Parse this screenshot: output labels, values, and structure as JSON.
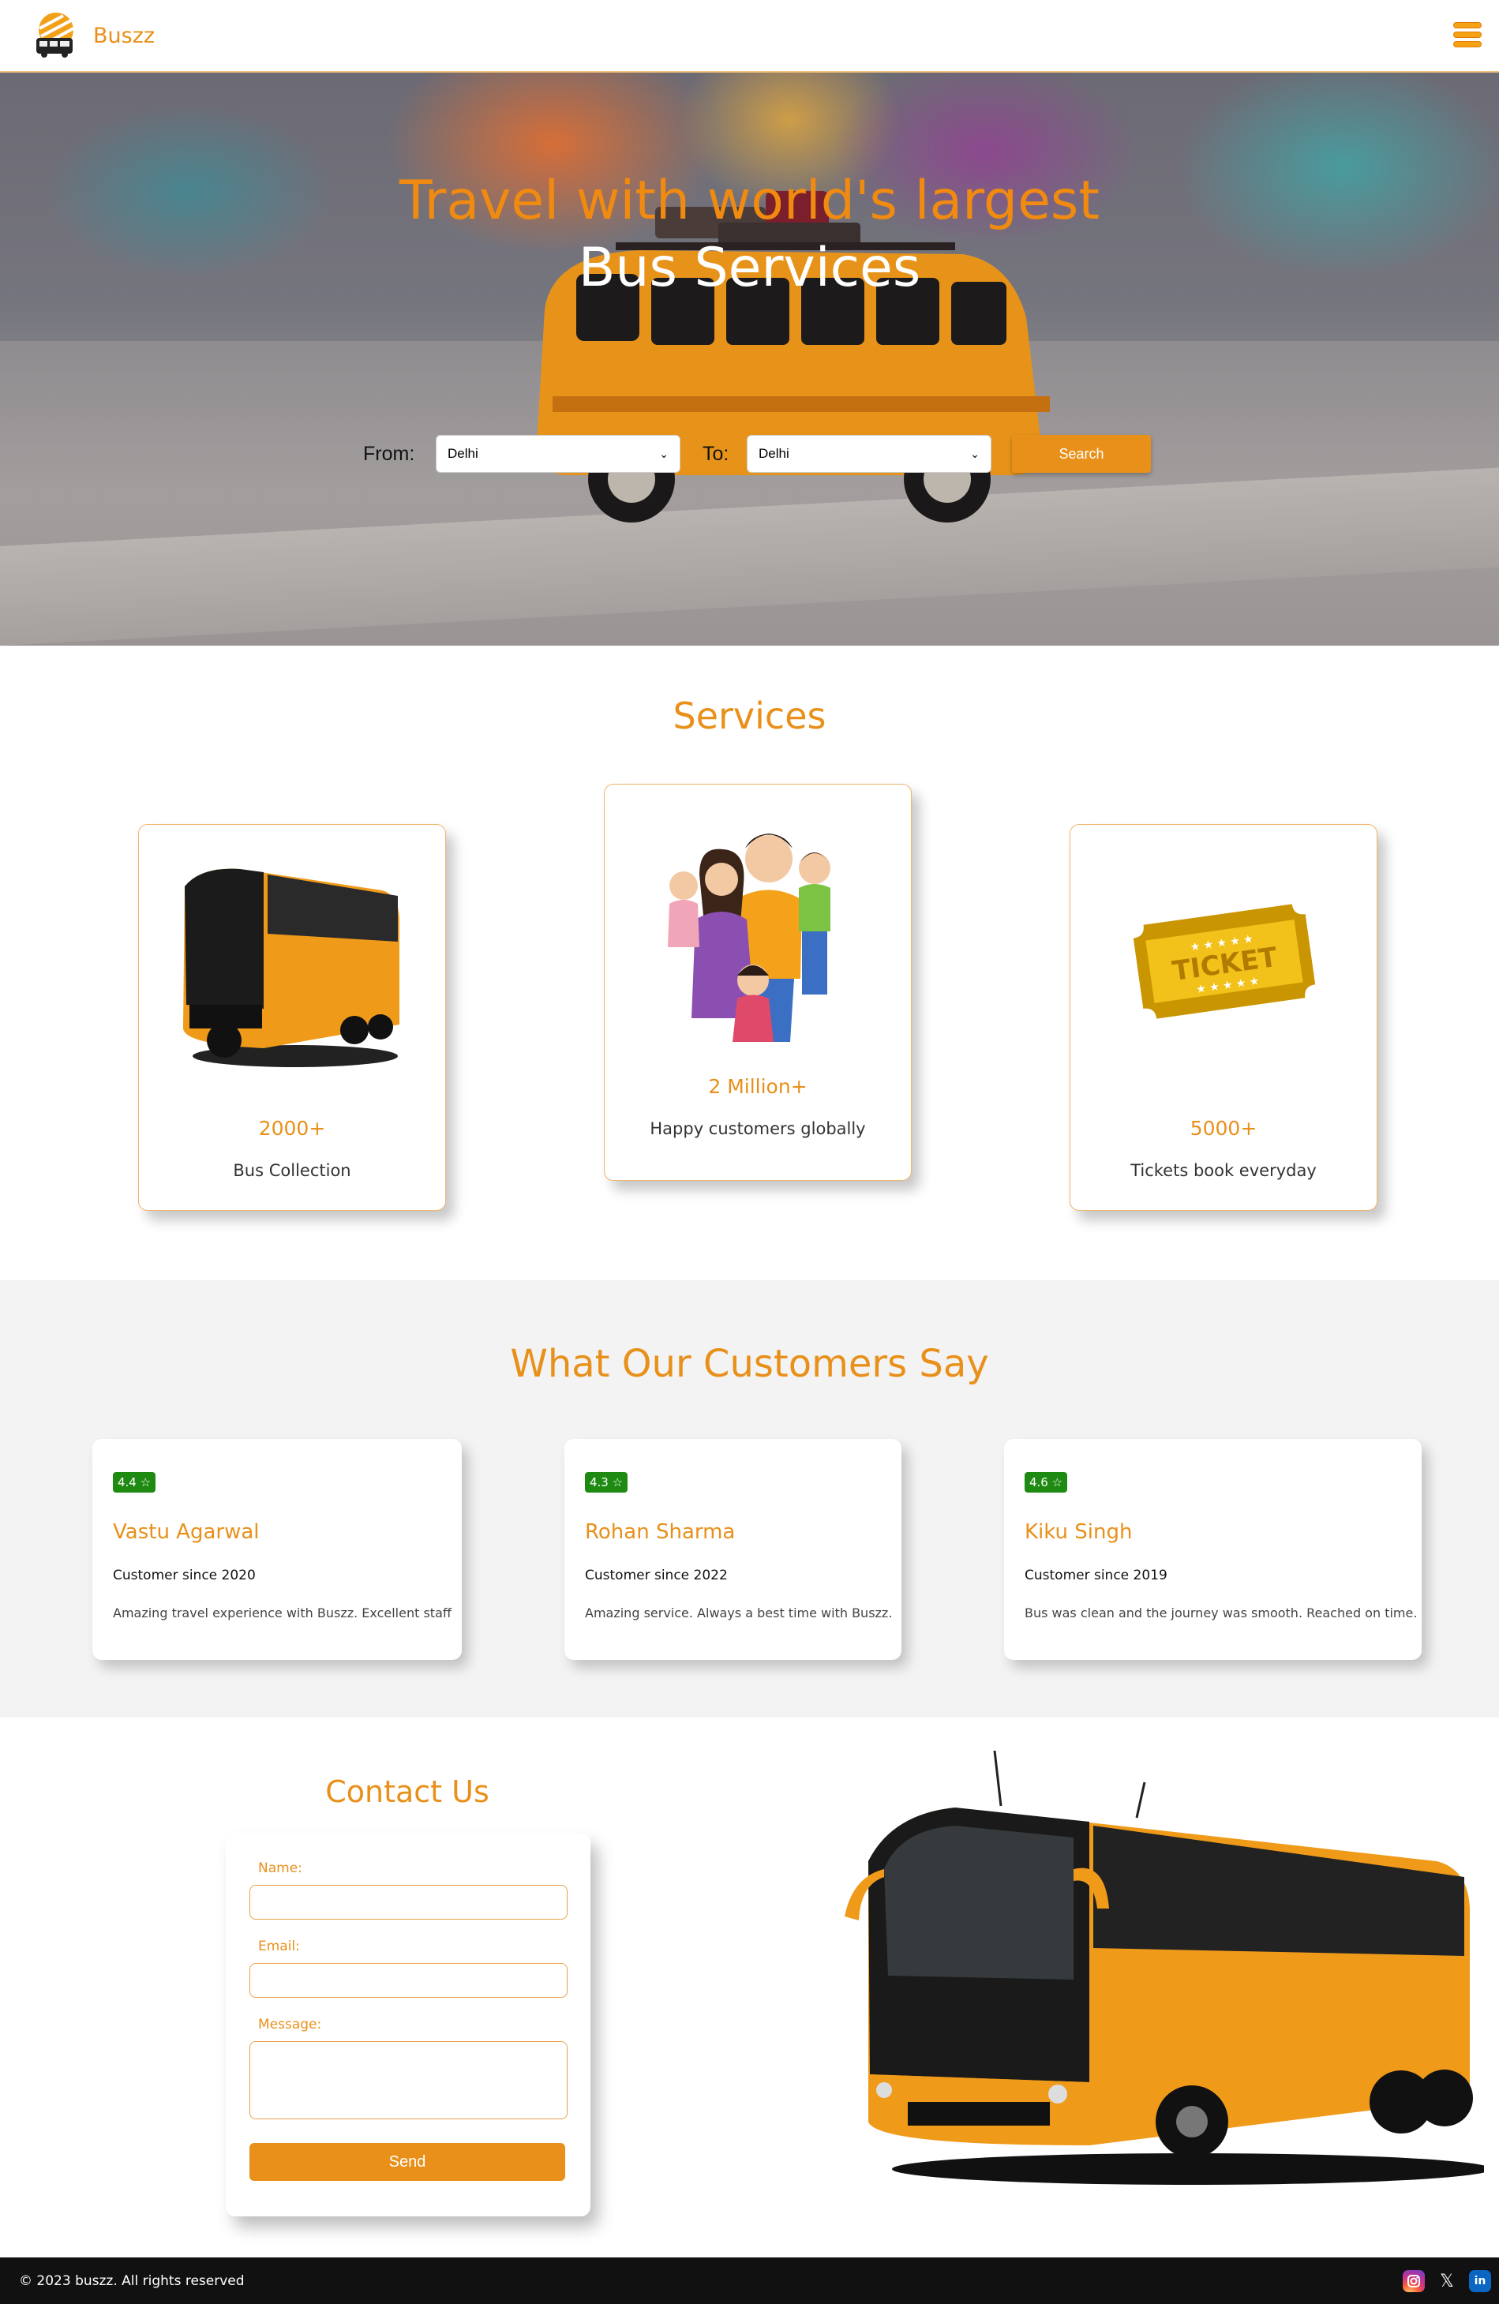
{
  "nav": {
    "brand": "Buszz"
  },
  "hero": {
    "title_line1": "Travel with world's largest",
    "title_line2": "Bus Services",
    "from_label": "From:",
    "from_value": "Delhi",
    "to_label": "To:",
    "to_value": "Delhi",
    "search_label": "Search"
  },
  "services": {
    "title": "Services",
    "cards": [
      {
        "number": "2000+",
        "label": "Bus Collection",
        "icon": "bus-icon"
      },
      {
        "number": "2 Million+",
        "label": "Happy customers globally",
        "icon": "family-icon"
      },
      {
        "number": "5000+",
        "label": "Tickets book everyday",
        "icon": "ticket-icon"
      }
    ]
  },
  "testimonials": {
    "title": "What Our Customers Say",
    "items": [
      {
        "rating": "4.4 ☆",
        "name": "Vastu Agarwal",
        "since": "Customer since 2020",
        "text": "Amazing travel experience with Buszz. Excellent staff"
      },
      {
        "rating": "4.3 ☆",
        "name": "Rohan Sharma",
        "since": "Customer since 2022",
        "text": "Amazing service. Always a best time with Buszz."
      },
      {
        "rating": "4.6 ☆",
        "name": "Kiku Singh",
        "since": "Customer since 2019",
        "text": "Bus was clean and the journey was smooth. Reached on time."
      }
    ]
  },
  "contact": {
    "title": "Contact Us",
    "name_label": "Name:",
    "email_label": "Email:",
    "message_label": "Message:",
    "send_label": "Send"
  },
  "footer": {
    "copyright": "© 2023 buszz. All rights reserved",
    "x_glyph": "𝕏",
    "linkedin_glyph": "in"
  },
  "colors": {
    "accent": "#e8901a",
    "rating": "#1f8a12",
    "footer": "#111111"
  }
}
